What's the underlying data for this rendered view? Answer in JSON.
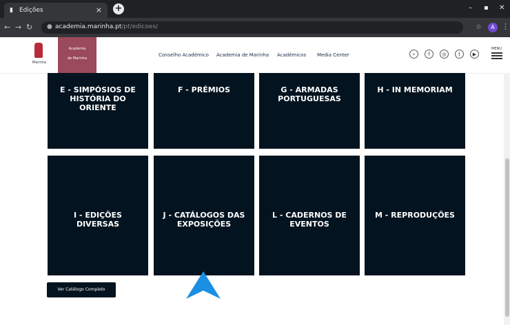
{
  "browser": {
    "tab_title": "Edições",
    "url_host": "academia.marinha.pt",
    "url_path": "/pt/edicoes/",
    "profile_letter": "A"
  },
  "site": {
    "logo_text": "Marinha",
    "academia_line1": "Academia",
    "academia_line2": "de Marinha",
    "nav": [
      "Conselho Académico",
      "Academia de Marinha",
      "Académicos",
      "Media Center"
    ],
    "menu_label": "MENU"
  },
  "tiles": [
    {
      "label": "E - SIMPÓSIOS DE HISTÓRIA DO ORIENTE"
    },
    {
      "label": "F - PRÉMIOS"
    },
    {
      "label": "G - ARMADAS PORTUGUESAS"
    },
    {
      "label": "H - IN MEMORIAM"
    },
    {
      "label": "I - EDIÇÕES DIVERSAS"
    },
    {
      "label": "J - CATÁLOGOS DAS EXPOSIÇÕES"
    },
    {
      "label": "L - CADERNOS DE EVENTOS"
    },
    {
      "label": "M - REPRODUÇÕES"
    }
  ],
  "catalog_button": "Ver Catálogo Completo",
  "colors": {
    "tile_bg": "#03131f",
    "academia_bg": "#9a4a5a",
    "pointer": "#1a8fe3"
  }
}
